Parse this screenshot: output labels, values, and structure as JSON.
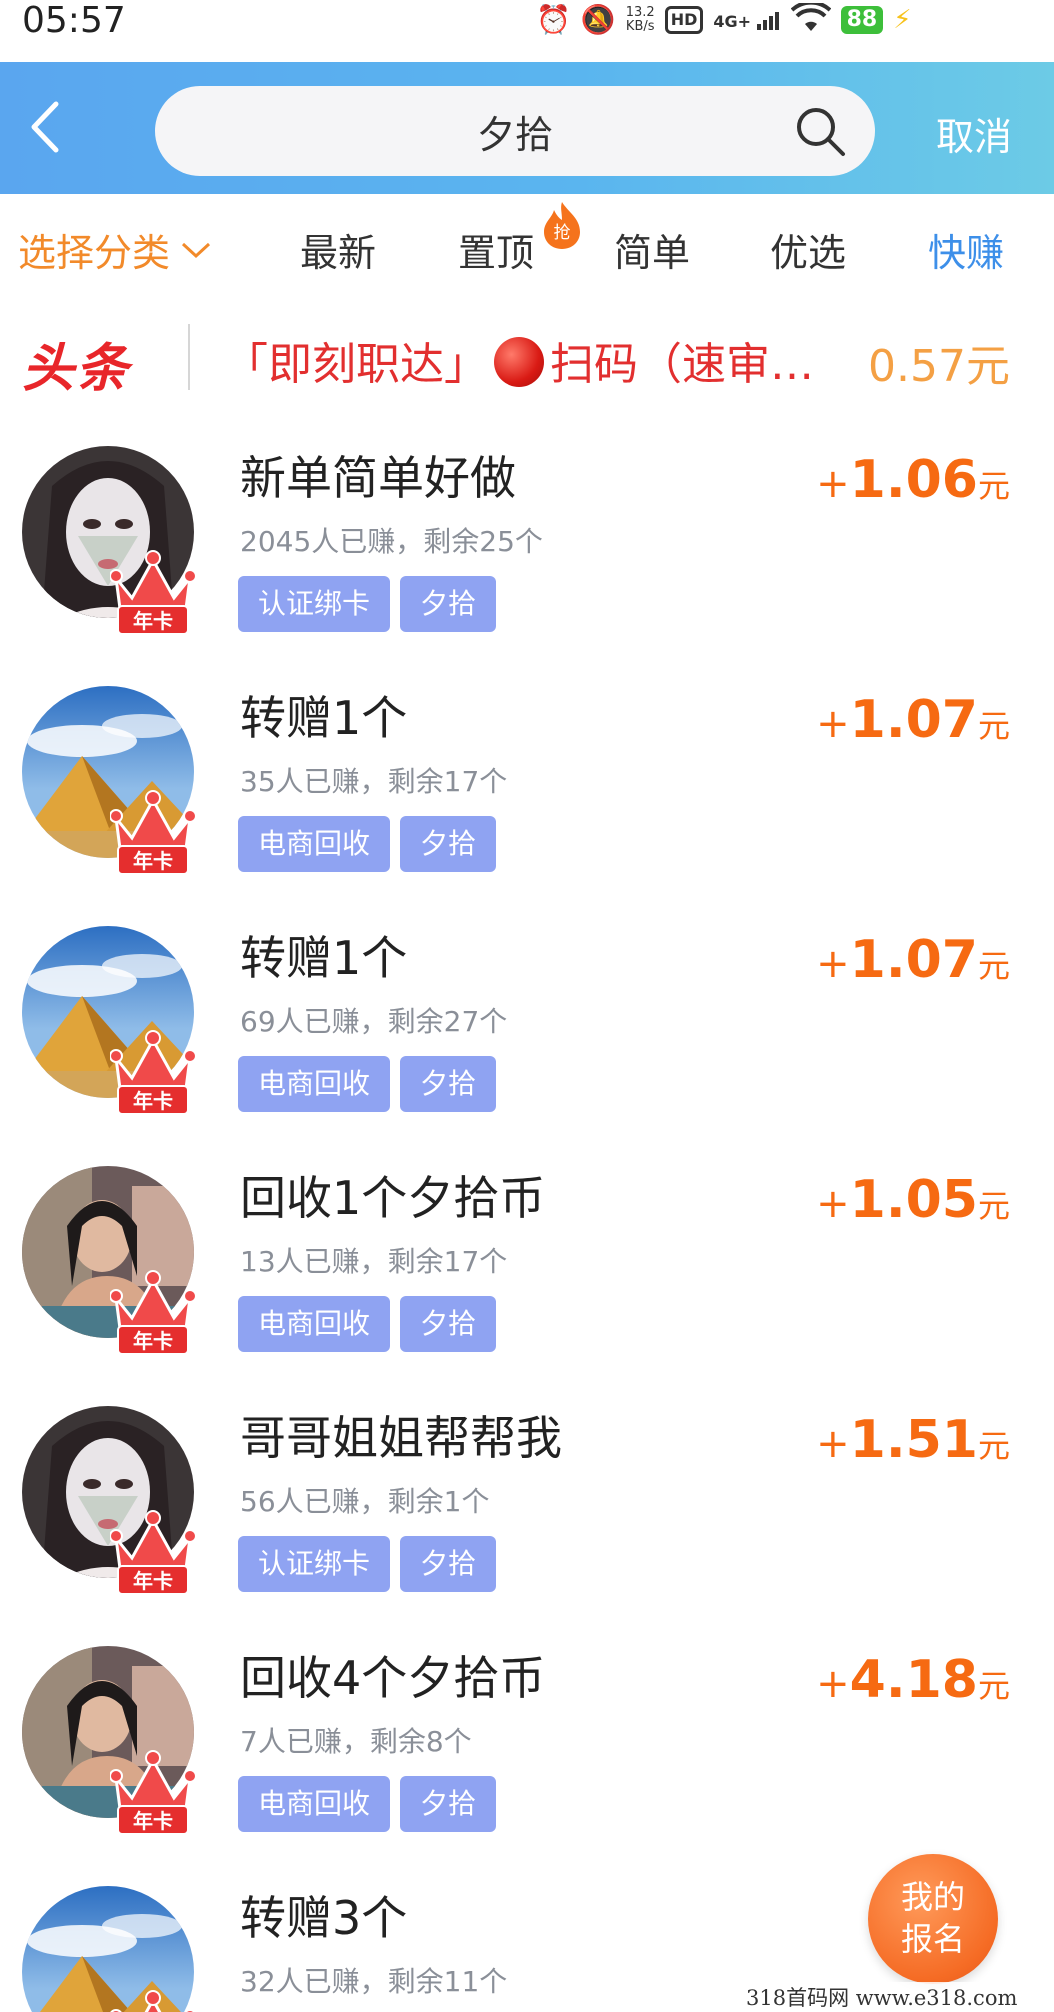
{
  "status_bar": {
    "time": "05:57",
    "net_speed_value": "13.2",
    "net_speed_unit": "KB/s",
    "hd": "HD",
    "network": "4G+",
    "battery": "88"
  },
  "search": {
    "query": "夕拾",
    "cancel_label": "取消"
  },
  "tabs": {
    "category_label": "选择分类",
    "items": [
      "最新",
      "置顶",
      "简单",
      "优选",
      "快赚"
    ],
    "pin_badge": "抢"
  },
  "headline": {
    "logo": "头条",
    "text_before": "「即刻职达」",
    "text_after": "扫码（速审…",
    "price": "0.57元"
  },
  "tasks": [
    {
      "title": "新单简单好做",
      "stats": "2045人已赚，剩余25个",
      "tags": [
        "认证绑卡",
        "夕拾"
      ],
      "reward": "1.06",
      "avatar": "girl"
    },
    {
      "title": "转赠1个",
      "stats": "35人已赚，剩余17个",
      "tags": [
        "电商回收",
        "夕拾"
      ],
      "reward": "1.07",
      "avatar": "pyramid"
    },
    {
      "title": "转赠1个",
      "stats": "69人已赚，剩余27个",
      "tags": [
        "电商回收",
        "夕拾"
      ],
      "reward": "1.07",
      "avatar": "pyramid"
    },
    {
      "title": "回收1个夕拾币",
      "stats": "13人已赚，剩余17个",
      "tags": [
        "电商回收",
        "夕拾"
      ],
      "reward": "1.05",
      "avatar": "woman"
    },
    {
      "title": "哥哥姐姐帮帮我",
      "stats": "56人已赚，剩余1个",
      "tags": [
        "认证绑卡",
        "夕拾"
      ],
      "reward": "1.51",
      "avatar": "girl"
    },
    {
      "title": "回收4个夕拾币",
      "stats": "7人已赚，剩余8个",
      "tags": [
        "电商回收",
        "夕拾"
      ],
      "reward": "4.18",
      "avatar": "woman"
    },
    {
      "title": "转赠3个",
      "stats": "32人已赚，剩余11个",
      "tags": [],
      "reward": "",
      "avatar": "pyramid"
    }
  ],
  "reward_plus": "+",
  "reward_unit": "元",
  "crown_label": "年卡",
  "fab": {
    "line1": "我的",
    "line2": "报名"
  },
  "watermark": "318首码网  www.e318.com",
  "colors": {
    "header": "#5ab0ef",
    "accent_orange": "#f66a12",
    "tag_bg": "#8fa3f2",
    "active_tab": "#3d8fe9",
    "headline_red": "#e22f2f"
  }
}
